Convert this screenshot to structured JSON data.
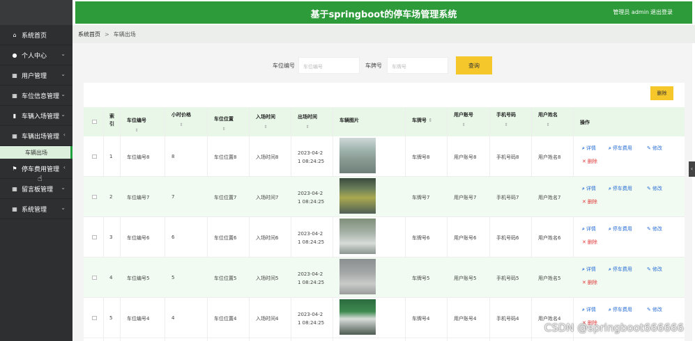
{
  "header": {
    "title": "基于springboot的停车场管理系统",
    "user": "管理员 admin",
    "logout": "退出登录"
  },
  "breadcrumb": {
    "home": "系统首页",
    "sep": ">",
    "current": "车辆出场"
  },
  "sidebar": {
    "items": [
      {
        "label": "系统首页",
        "icon": "home-icon"
      },
      {
        "label": "个人中心",
        "icon": "user-icon"
      },
      {
        "label": "用户管理",
        "icon": "grid-icon"
      },
      {
        "label": "车位信息管理",
        "icon": "grid-icon"
      },
      {
        "label": "车辆入场管理",
        "icon": "clipboard-icon"
      },
      {
        "label": "车辆出场管理",
        "icon": "grid-icon"
      },
      {
        "label": "停车费用管理",
        "icon": "flag-icon"
      },
      {
        "label": "留言板管理",
        "icon": "grid-icon"
      },
      {
        "label": "系统管理",
        "icon": "grid-icon"
      }
    ],
    "sub_item": "车辆出场"
  },
  "search": {
    "spot_label": "车位编号",
    "spot_placeholder": "车位编号",
    "plate_label": "车牌号",
    "plate_placeholder": "车牌号",
    "button": "查询"
  },
  "toolbar": {
    "delete": "删除"
  },
  "table": {
    "headers": [
      "索引",
      "车位编号",
      "小时价格",
      "车位位置",
      "入场时间",
      "出场时间",
      "车辆图片",
      "车牌号",
      "用户账号",
      "手机号码",
      "用户姓名",
      "操作"
    ],
    "index_header_line1": "索",
    "index_header_line2": "引",
    "rows": [
      {
        "idx": "1",
        "spot": "车位编号8",
        "price": "8",
        "location": "车位位置8",
        "in_time": "入场时间8",
        "out1": "2023-04-2",
        "out2": "1 08:24:25",
        "plate": "车牌号8",
        "account": "用户账号8",
        "phone": "手机号码8",
        "name": "用户姓名8"
      },
      {
        "idx": "2",
        "spot": "车位编号7",
        "price": "7",
        "location": "车位位置7",
        "in_time": "入场时间7",
        "out1": "2023-04-2",
        "out2": "1 08:24:25",
        "plate": "车牌号7",
        "account": "用户账号7",
        "phone": "手机号码7",
        "name": "用户姓名7"
      },
      {
        "idx": "3",
        "spot": "车位编号6",
        "price": "6",
        "location": "车位位置6",
        "in_time": "入场时间6",
        "out1": "2023-04-2",
        "out2": "1 08:24:25",
        "plate": "车牌号6",
        "account": "用户账号6",
        "phone": "手机号码6",
        "name": "用户姓名6"
      },
      {
        "idx": "4",
        "spot": "车位编号5",
        "price": "5",
        "location": "车位位置5",
        "in_time": "入场时间5",
        "out1": "2023-04-2",
        "out2": "1 08:24:25",
        "plate": "车牌号5",
        "account": "用户账号5",
        "phone": "手机号码5",
        "name": "用户姓名5"
      },
      {
        "idx": "5",
        "spot": "车位编号4",
        "price": "4",
        "location": "车位位置4",
        "in_time": "入场时间4",
        "out1": "2023-04-2",
        "out2": "1 08:24:25",
        "plate": "车牌号4",
        "account": "用户账号4",
        "phone": "手机号码4",
        "name": "用户姓名4"
      }
    ],
    "actions": {
      "detail": "详情",
      "fee": "停车费用",
      "edit": "修改",
      "delete": "删除"
    }
  },
  "watermark": "CSDN @springboot666666",
  "colors": {
    "header_green": "#2d9b3a",
    "sidebar_dark": "#2e2f31",
    "button_yellow": "#f5c72a",
    "link_blue": "#2a6fd6",
    "delete_red": "#e03a3a"
  }
}
